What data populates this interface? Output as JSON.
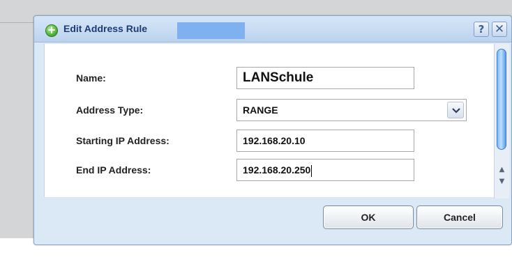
{
  "dialog": {
    "title": "Edit Address Rule",
    "help_label": "?",
    "close_label": "✕",
    "add_icon_glyph": "+"
  },
  "form": {
    "name_label": "Name:",
    "name_value": "LANSchule",
    "address_type_label": "Address Type:",
    "address_type_value": "RANGE",
    "start_ip_label": "Starting IP Address:",
    "start_ip_value": "192.168.20.10",
    "end_ip_label": "End IP Address:",
    "end_ip_value": "192.168.20.250"
  },
  "buttons": {
    "ok_label": "OK",
    "cancel_label": "Cancel"
  },
  "scrollbar": {
    "up_glyph": "▲",
    "down_glyph": "▼"
  },
  "colors": {
    "title_text": "#1f3b73",
    "dialog_bg": "#dbe8f6",
    "accent_blue": "#7fb0f0"
  }
}
